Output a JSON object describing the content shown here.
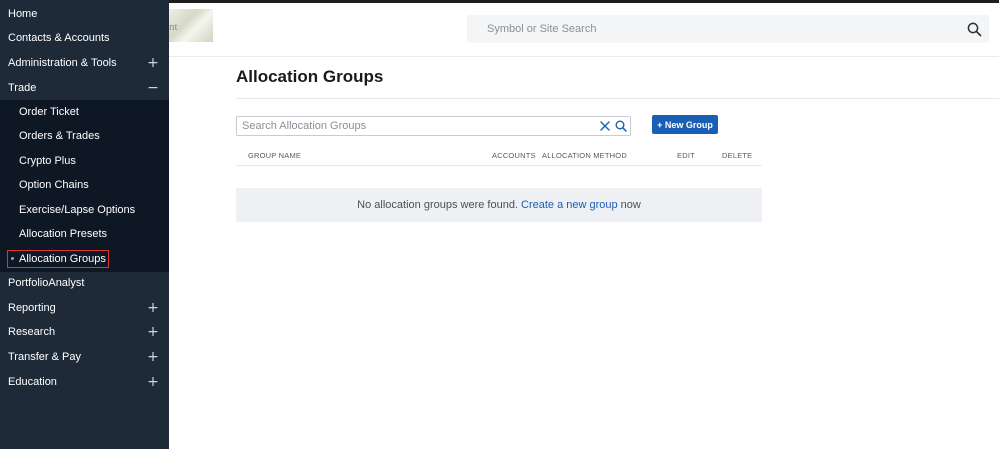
{
  "sidebar": {
    "items": [
      {
        "label": "Home",
        "level": "top"
      },
      {
        "label": "Contacts & Accounts",
        "level": "top"
      },
      {
        "label": "Administration & Tools",
        "level": "top",
        "toggle": "+"
      },
      {
        "label": "Trade",
        "level": "top",
        "toggle": "−"
      },
      {
        "label": "Order Ticket",
        "level": "sub"
      },
      {
        "label": "Orders & Trades",
        "level": "sub"
      },
      {
        "label": "Crypto Plus",
        "level": "sub"
      },
      {
        "label": "Option Chains",
        "level": "sub"
      },
      {
        "label": "Exercise/Lapse Options",
        "level": "sub"
      },
      {
        "label": "Allocation Presets",
        "level": "sub"
      },
      {
        "label": "Allocation Groups",
        "level": "sub",
        "active": true
      },
      {
        "label": "PortfolioAnalyst",
        "level": "top"
      },
      {
        "label": "Reporting",
        "level": "top",
        "toggle": "+"
      },
      {
        "label": "Research",
        "level": "top",
        "toggle": "+"
      },
      {
        "label": "Transfer & Pay",
        "level": "top",
        "toggle": "+"
      },
      {
        "label": "Education",
        "level": "top",
        "toggle": "+"
      }
    ]
  },
  "header": {
    "logo_text": "nt",
    "search_placeholder": "Symbol or Site Search"
  },
  "main": {
    "title": "Allocation Groups",
    "search_placeholder": "Search Allocation Groups",
    "new_group_label": "+ New Group",
    "columns": [
      "GROUP NAME",
      "ACCOUNTS",
      "ALLOCATION METHOD",
      "EDIT",
      "DELETE"
    ],
    "empty": {
      "prefix": "No allocation groups were found.",
      "link": "Create a new group",
      "suffix": "now"
    }
  },
  "colors": {
    "sidebar_bg": "#1e2a38",
    "sidebar_sub_bg": "#0e1825",
    "accent_blue": "#1a5fb4",
    "active_outline": "#e0342b"
  },
  "icons": {
    "header_search": "search-icon",
    "clear": "close-icon",
    "groups_search": "search-icon",
    "expand": "plus-icon",
    "collapse": "minus-icon"
  }
}
